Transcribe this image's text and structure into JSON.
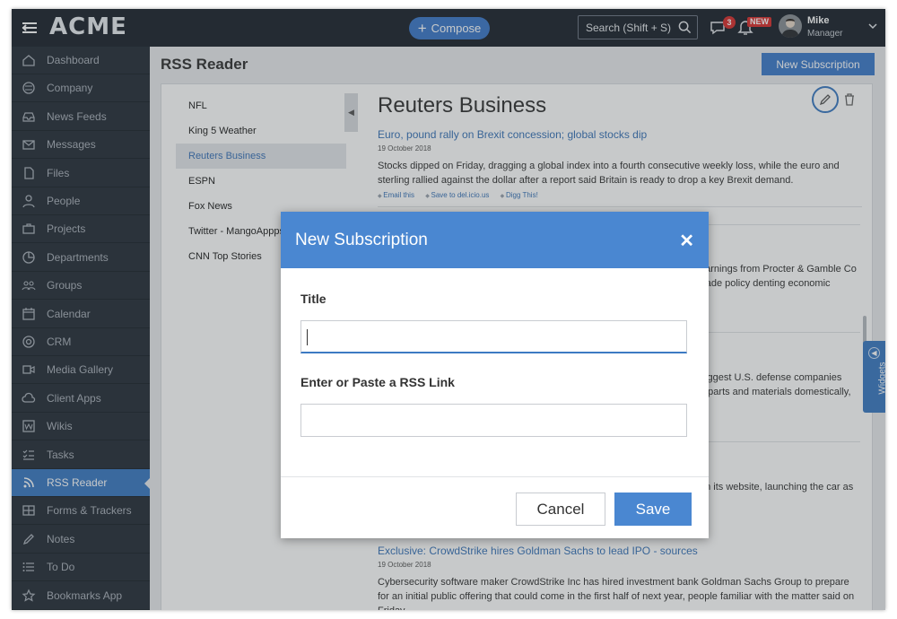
{
  "topbar": {
    "logo": "ACME",
    "compose_label": "Compose",
    "search_placeholder": "Search (Shift + S)",
    "chat_badge": "3",
    "notification_badge": "NEW",
    "user_name": "Mike",
    "user_role": "Manager"
  },
  "sidebar": {
    "items": [
      {
        "label": "Dashboard",
        "icon": "home-icon"
      },
      {
        "label": "Company",
        "icon": "globe-icon"
      },
      {
        "label": "News Feeds",
        "icon": "inbox-icon"
      },
      {
        "label": "Messages",
        "icon": "envelope-icon"
      },
      {
        "label": "Files",
        "icon": "file-icon"
      },
      {
        "label": "People",
        "icon": "person-icon"
      },
      {
        "label": "Projects",
        "icon": "briefcase-icon"
      },
      {
        "label": "Departments",
        "icon": "pie-chart-icon"
      },
      {
        "label": "Groups",
        "icon": "group-icon"
      },
      {
        "label": "Calendar",
        "icon": "calendar-icon"
      },
      {
        "label": "CRM",
        "icon": "target-icon"
      },
      {
        "label": "Media Gallery",
        "icon": "video-icon"
      },
      {
        "label": "Client Apps",
        "icon": "cloud-icon"
      },
      {
        "label": "Wikis",
        "icon": "wiki-icon"
      },
      {
        "label": "Tasks",
        "icon": "checklist-icon"
      },
      {
        "label": "RSS Reader",
        "icon": "rss-icon"
      },
      {
        "label": "Forms & Trackers",
        "icon": "table-icon"
      },
      {
        "label": "Notes",
        "icon": "pencil-icon"
      },
      {
        "label": "To Do",
        "icon": "list-icon"
      },
      {
        "label": "Bookmarks App",
        "icon": "star-icon"
      }
    ],
    "active_index": 15
  },
  "main": {
    "page_title": "RSS Reader",
    "new_subscription_label": "New Subscription",
    "feeds": [
      "NFL",
      "King 5 Weather",
      "Reuters Business",
      "ESPN",
      "Fox News",
      "Twitter - MangoAppps",
      "CNN Top Stories"
    ],
    "selected_feed_index": 2,
    "feed_title": "Reuters Business",
    "articles": [
      {
        "title": "Euro, pound rally on Brexit concession; global stocks dip",
        "date": "19 October 2018",
        "body": "Stocks dipped on Friday, dragging a global index into a fourth consecutive weekly loss, while the euro and sterling rallied against the dollar after a report said Britain is ready to drop a key Brexit demand.",
        "actions": [
          "Email this",
          "Save to del.icio.us",
          "Digg This!"
        ]
      }
    ],
    "partial_lines": [
      "earnings from Procter & Gamble Co",
      "trade policy denting economic",
      "biggest U.S. defense companies",
      "e parts and materials domestically,",
      "on its website, launching the car as"
    ],
    "last_article": {
      "title": "Exclusive: CrowdStrike hires Goldman Sachs to lead IPO - sources",
      "date": "19 October 2018",
      "body": "Cybersecurity software maker CrowdStrike Inc has hired investment bank Goldman Sachs Group to prepare for an initial public offering that could come in the first half of next year, people familiar with the matter said on Friday."
    },
    "widgets_label": "Widgets"
  },
  "modal": {
    "title": "New Subscription",
    "title_field_label": "Title",
    "title_field_value": "",
    "link_field_label": "Enter or Paste a RSS Link",
    "link_field_value": "",
    "cancel_label": "Cancel",
    "save_label": "Save"
  },
  "colors": {
    "accent": "#3c7ac3",
    "topbar": "#1e252e",
    "sidebar": "#283039",
    "badge": "#d9302f"
  }
}
